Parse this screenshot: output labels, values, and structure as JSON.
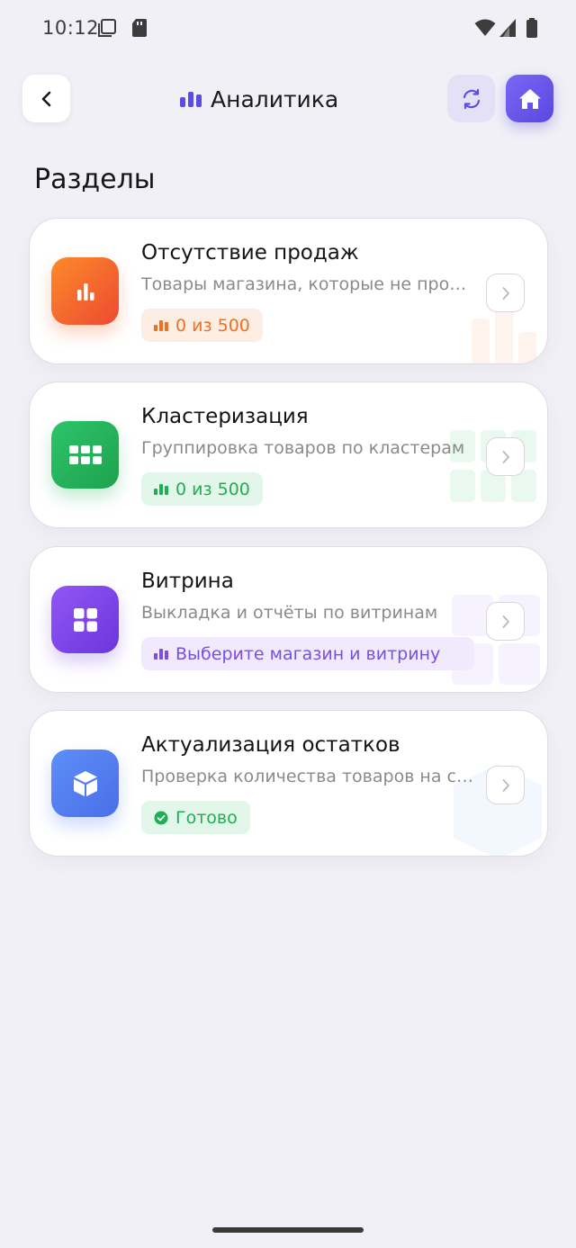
{
  "status_bar": {
    "time": "10:12",
    "icons": [
      "screenshot-icon",
      "sd-card-icon",
      "wifi-icon",
      "signal-icon",
      "battery-icon"
    ]
  },
  "header": {
    "title": "Аналитика",
    "title_icon": "bar-chart-icon",
    "back_icon": "chevron-left-icon",
    "refresh_icon": "refresh-icon",
    "home_icon": "home-icon"
  },
  "section_title": "Разделы",
  "cards": [
    {
      "title": "Отсутствие продаж",
      "description": "Товары магазина, которые не продаются",
      "badge": "0 из 500",
      "icon": "bar-chart-icon",
      "color": "#f26a26",
      "badge_color": "#f0701f",
      "badge_bg": "#fdeee3"
    },
    {
      "title": "Кластеризация",
      "description": "Группировка товаров по кластерам",
      "badge": "0 из 500",
      "icon": "grid-six-icon",
      "color": "#22b358",
      "badge_color": "#1fae55",
      "badge_bg": "#e3f6ea"
    },
    {
      "title": "Витрина",
      "description": "Выкладка и отчёты по витринам",
      "badge": "Выберите магазин и витрину",
      "icon": "grid-four-icon",
      "color": "#7e47ea",
      "badge_color": "#7a4fe0",
      "badge_bg": "#f0eafc"
    },
    {
      "title": "Актуализация остатков",
      "description": "Проверка количества товаров на складе",
      "badge": "Готово",
      "icon": "box-icon",
      "color": "#4f7ef0",
      "badge_color": "#1fae55",
      "badge_bg": "#e3f6ea"
    }
  ]
}
